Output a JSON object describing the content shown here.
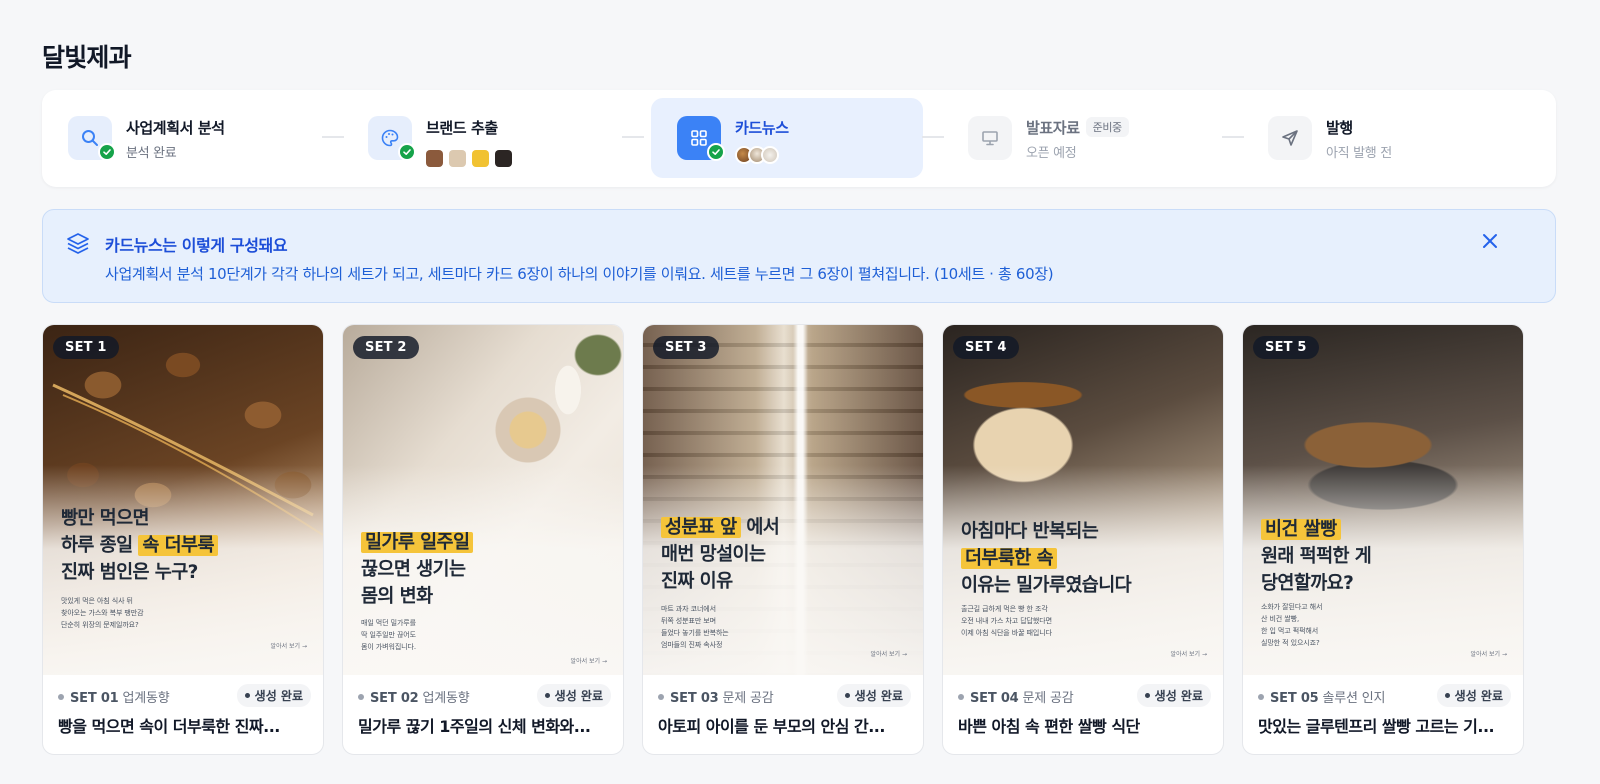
{
  "page_title": "달빛제과",
  "steps": [
    {
      "name": "사업계획서 분석",
      "sub": "분석 완료",
      "icon": "search-icon",
      "state": "done"
    },
    {
      "name": "브랜드 추출",
      "icon": "palette-icon",
      "state": "done",
      "swatches": [
        "#8b5a3c",
        "#dcc9b0",
        "#f1c232",
        "#2b2523"
      ]
    },
    {
      "name": "카드뉴스",
      "icon": "grid-icon",
      "state": "active"
    },
    {
      "name": "발표자료",
      "badge": "준비중",
      "sub": "오픈 예정",
      "icon": "presentation-icon",
      "state": "pending"
    },
    {
      "name": "발행",
      "sub": "아직 발행 전",
      "icon": "send-icon",
      "state": "pending"
    }
  ],
  "info": {
    "title": "카드뉴스는 이렇게 구성돼요",
    "description": "사업계획서 분석 10단계가 각각 하나의 세트가 되고, 세트마다 카드 6장이 하나의 이야기를 이뤄요. 세트를 누르면 그 6장이 펼쳐집니다. (10세트 · 총 60장)"
  },
  "cards": [
    {
      "pill": "SET 1",
      "headline_1": "빵만 먹으면",
      "headline_2a": "하루 종일 ",
      "headline_2b": "속 더부룩",
      "headline_3": "진짜 범인은 누구?",
      "small_1": "맛있게 먹은 아침 식사 뒤",
      "small_2": "찾아오는 가스와 복부 팽만감",
      "small_3": "단순히 위장의 문제일까요?",
      "more": "알아서 보기 →",
      "set_no": "SET 01",
      "category": "업계동향",
      "status": "생성 완료",
      "title": "빵을 먹으면 속이 더부룩한 진짜..."
    },
    {
      "pill": "SET 2",
      "headline_1": "밀가루 일주일",
      "headline_2": "끊으면 생기는",
      "headline_3": "몸의 변화",
      "small_1": "매일 먹던 밀가루를",
      "small_2": "딱 일주일만 끊어도",
      "small_3": "몸이 가벼워집니다.",
      "more": "알아서 보기 →",
      "set_no": "SET 02",
      "category": "업계동향",
      "status": "생성 완료",
      "title": "밀가루 끊기 1주일의 신체 변화와..."
    },
    {
      "pill": "SET 3",
      "headline_1a": "성분표 앞",
      "headline_1b": " 에서",
      "headline_2": "매번 망설이는",
      "headline_3": "진짜 이유",
      "small_1": "마트 과자 코너에서",
      "small_2": "뒤쪽 성분표만 보며",
      "small_3": "들었다 놓기를 반복하는",
      "small_4": "엄마들의 진짜 속사정",
      "more": "알아서 보기 →",
      "set_no": "SET 03",
      "category": "문제 공감",
      "status": "생성 완료",
      "title": "아토피 아이를 둔 부모의 안심 간..."
    },
    {
      "pill": "SET 4",
      "headline_1": "아침마다 반복되는",
      "headline_2": "더부룩한 속",
      "headline_3": "이유는 밀가루였습니다",
      "small_1": "출근길 급하게 먹은 빵 한 조각",
      "small_2": "오전 내내 가스 차고 답답했다면",
      "small_3": "이제 아침 식단을 바꿀 때입니다",
      "more": "알아서 보기 →",
      "set_no": "SET 04",
      "category": "문제 공감",
      "status": "생성 완료",
      "title": "바쁜 아침 속 편한 쌀빵 식단"
    },
    {
      "pill": "SET 5",
      "headline_1": "비건 쌀빵",
      "headline_2": "원래 퍽퍽한 게",
      "headline_3": "당연할까요?",
      "small_1": "소화가 잘된다고 해서",
      "small_2": "산 비건 쌀빵,",
      "small_3": "한 입 먹고 퍽퍽해서",
      "small_4": "실망한 적 있으시죠?",
      "more": "알아서 보기 →",
      "set_no": "SET 05",
      "category": "솔루션 인지",
      "status": "생성 완료",
      "title": "맛있는 글루텐프리 쌀빵 고르는 기..."
    }
  ],
  "colors": {
    "accent": "#3b82f6",
    "success": "#16a34a",
    "highlight": "#f5c43a"
  }
}
